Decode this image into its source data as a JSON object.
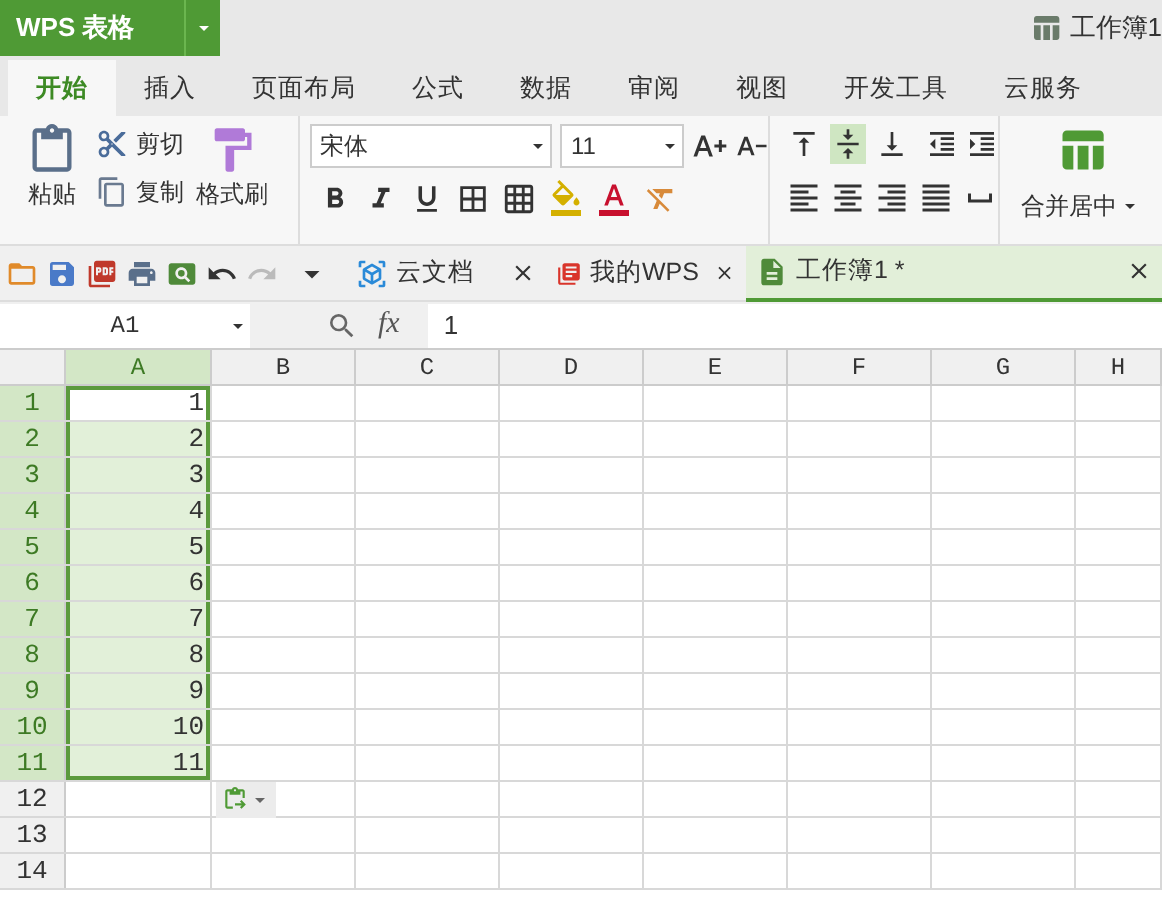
{
  "app_menu": {
    "label": "WPS 表格"
  },
  "document_title": "工作簿1",
  "ribbon_tabs": [
    {
      "label": "开始",
      "selected": true
    },
    {
      "label": "插入",
      "selected": false
    },
    {
      "label": "页面布局",
      "selected": false
    },
    {
      "label": "公式",
      "selected": false
    },
    {
      "label": "数据",
      "selected": false
    },
    {
      "label": "审阅",
      "selected": false
    },
    {
      "label": "视图",
      "selected": false
    },
    {
      "label": "开发工具",
      "selected": false
    },
    {
      "label": "云服务",
      "selected": false
    }
  ],
  "clipboard": {
    "paste": "粘贴",
    "cut": "剪切",
    "copy": "复制",
    "format_painter": "格式刷"
  },
  "font": {
    "name": "宋体",
    "size": "11"
  },
  "vertical_align": [
    {
      "kind": "top",
      "selected": false
    },
    {
      "kind": "middle",
      "selected": true
    },
    {
      "kind": "bottom",
      "selected": false
    }
  ],
  "merge": {
    "label": "合并居中"
  },
  "doc_tabs": [
    {
      "kind": "cloud",
      "label": "云文档",
      "selected": false
    },
    {
      "kind": "wps",
      "label": "我的WPS",
      "selected": false
    },
    {
      "kind": "sheet",
      "label": "工作簿1 *",
      "selected": true
    }
  ],
  "name_box": "A1",
  "fx_label": "fx",
  "formula": "1",
  "columns": [
    {
      "label": "A",
      "selected": true
    },
    {
      "label": "B",
      "selected": false
    },
    {
      "label": "C",
      "selected": false
    },
    {
      "label": "D",
      "selected": false
    },
    {
      "label": "E",
      "selected": false
    },
    {
      "label": "F",
      "selected": false
    },
    {
      "label": "G",
      "selected": false
    },
    {
      "label": "H",
      "selected": false
    }
  ],
  "rows": [
    {
      "label": "1",
      "selected": true,
      "value": "1"
    },
    {
      "label": "2",
      "selected": true,
      "value": "2"
    },
    {
      "label": "3",
      "selected": true,
      "value": "3"
    },
    {
      "label": "4",
      "selected": true,
      "value": "4"
    },
    {
      "label": "5",
      "selected": true,
      "value": "5"
    },
    {
      "label": "6",
      "selected": true,
      "value": "6"
    },
    {
      "label": "7",
      "selected": true,
      "value": "7"
    },
    {
      "label": "8",
      "selected": true,
      "value": "8"
    },
    {
      "label": "9",
      "selected": true,
      "value": "9"
    },
    {
      "label": "10",
      "selected": true,
      "value": "10"
    },
    {
      "label": "11",
      "selected": true,
      "value": "11"
    },
    {
      "label": "12",
      "selected": false
    },
    {
      "label": "13",
      "selected": false
    },
    {
      "label": "14",
      "selected": false
    }
  ]
}
